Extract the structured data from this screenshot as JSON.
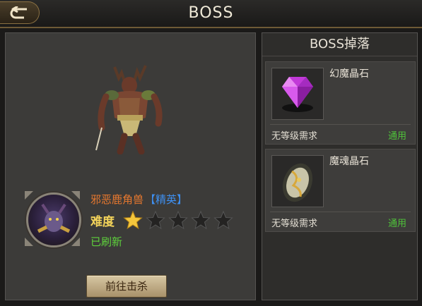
{
  "header": {
    "title": "BOSS"
  },
  "boss": {
    "name": "邪恶鹿角兽",
    "rank": "【精英】",
    "difficulty_label": "难度",
    "difficulty_stars": 1,
    "difficulty_max": 5,
    "status": "已刷新",
    "go_button": "前往击杀"
  },
  "drops": {
    "title": "BOSS掉落",
    "items": [
      {
        "name": "幻魔晶石",
        "requirement": "无等级需求",
        "usage": "通用",
        "icon": "purple-gem-icon"
      },
      {
        "name": "魔魂晶石",
        "requirement": "无等级需求",
        "usage": "通用",
        "icon": "soul-crystal-icon"
      }
    ]
  },
  "colors": {
    "name_orange": "#e8782e",
    "rank_blue": "#3e8ff0",
    "difficulty_yellow": "#f3d35a",
    "status_green": "#5ed13c"
  }
}
